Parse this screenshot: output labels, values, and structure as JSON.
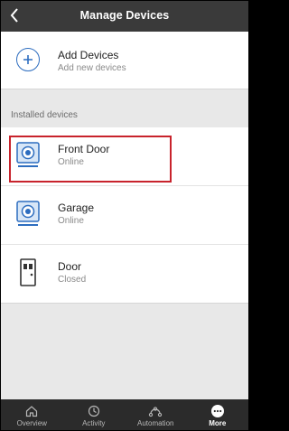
{
  "header": {
    "title": "Manage Devices"
  },
  "add_devices": {
    "title": "Add Devices",
    "subtitle": "Add new devices"
  },
  "section_label": "Installed devices",
  "devices": [
    {
      "name": "Front Door",
      "status": "Online",
      "icon": "camera-icon"
    },
    {
      "name": "Garage",
      "status": "Online",
      "icon": "camera-icon"
    },
    {
      "name": "Door",
      "status": "Closed",
      "icon": "door-sensor-icon"
    }
  ],
  "tabs": [
    {
      "label": "Overview",
      "icon": "home-icon"
    },
    {
      "label": "Activity",
      "icon": "activity-icon"
    },
    {
      "label": "Automation",
      "icon": "automation-icon"
    },
    {
      "label": "More",
      "icon": "more-icon",
      "active": true
    }
  ],
  "colors": {
    "accent": "#2d6dbf",
    "header": "#3a3a3a",
    "highlight": "#c8232c",
    "tabbar": "#2b2b2b"
  }
}
